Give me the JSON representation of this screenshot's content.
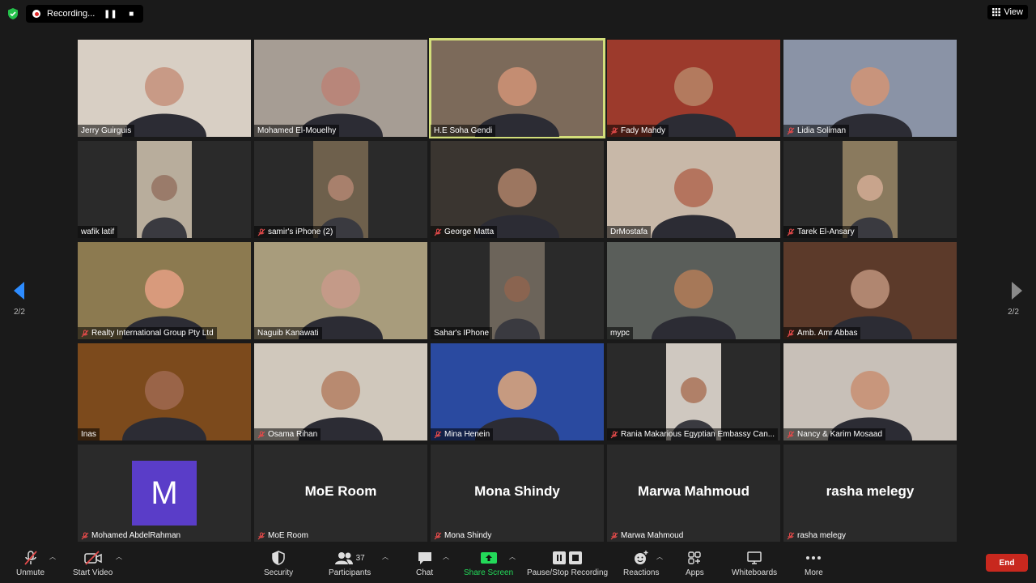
{
  "top_bar": {
    "recording_label": "Recording...",
    "view_label": "View"
  },
  "navigation": {
    "page_indicator_left": "2/2",
    "page_indicator_right": "2/2"
  },
  "participants": [
    {
      "name": "Jerry Guirguis",
      "muted": false,
      "bg": "#d8cfc4",
      "face": "#c89a86",
      "portrait": false,
      "active": false
    },
    {
      "name": "Mohamed El-Mouelhy",
      "muted": false,
      "bg": "#a69d94",
      "face": "#b8867a",
      "portrait": false,
      "active": false
    },
    {
      "name": "H.E Soha Gendi",
      "muted": false,
      "bg": "#7c6a5a",
      "face": "#c48d72",
      "portrait": false,
      "active": true
    },
    {
      "name": "Fady Mahdy",
      "muted": true,
      "bg": "#9c3a2c",
      "face": "#b37a5e",
      "portrait": false,
      "active": false
    },
    {
      "name": "Lidia Soliman",
      "muted": true,
      "bg": "#8a93a6",
      "face": "#c8947c",
      "portrait": false,
      "active": false
    },
    {
      "name": "wafik latif",
      "muted": false,
      "bg": "#b8ad9c",
      "face": "#9a7b6a",
      "portrait": true,
      "active": false
    },
    {
      "name": "samir's iPhone (2)",
      "muted": true,
      "bg": "#6e604c",
      "face": "#a8806c",
      "portrait": true,
      "active": false
    },
    {
      "name": "George Matta",
      "muted": true,
      "bg": "#3a3530",
      "face": "#9c7660",
      "portrait": false,
      "active": false
    },
    {
      "name": "DrMostafa",
      "muted": false,
      "bg": "#c8b8a8",
      "face": "#b4745e",
      "portrait": false,
      "active": false
    },
    {
      "name": "Tarek El-Ansary",
      "muted": true,
      "bg": "#8a7a5e",
      "face": "#c8a48c",
      "portrait": true,
      "active": false
    },
    {
      "name": "Realty International Group Pty Ltd",
      "muted": true,
      "bg": "#8c7a50",
      "face": "#d89a7c",
      "portrait": false,
      "active": false
    },
    {
      "name": "Naguib Kanawati",
      "muted": false,
      "bg": "#a89c7c",
      "face": "#c49a88",
      "portrait": false,
      "active": false
    },
    {
      "name": "Sahar's IPhone",
      "muted": false,
      "bg": "#6c645a",
      "face": "#8a6450",
      "portrait": true,
      "active": false
    },
    {
      "name": "mypc",
      "muted": false,
      "bg": "#5a5e5a",
      "face": "#a67858",
      "portrait": false,
      "active": false
    },
    {
      "name": "Amb. Amr Abbas",
      "muted": true,
      "bg": "#5c3a2a",
      "face": "#b08670",
      "portrait": false,
      "active": false
    },
    {
      "name": "Inas",
      "muted": false,
      "bg": "#7c4a1c",
      "face": "#9a6448",
      "portrait": false,
      "active": false
    },
    {
      "name": "Osama Rihan",
      "muted": true,
      "bg": "#d0c8bc",
      "face": "#b88a70",
      "portrait": false,
      "active": false
    },
    {
      "name": "Mina Henein",
      "muted": true,
      "bg": "#2a4aa0",
      "face": "#c69a80",
      "portrait": false,
      "active": false
    },
    {
      "name": "Rania Makarious Egyptian Embassy Can...",
      "muted": true,
      "bg": "#cfc8c0",
      "face": "#b08068",
      "portrait": true,
      "active": false
    },
    {
      "name": "Nancy & Karim Mosaad",
      "muted": true,
      "bg": "#c8c0b8",
      "face": "#c8967c",
      "portrait": false,
      "active": false
    }
  ],
  "no_video": [
    {
      "name": "Mohamed AbdelRahman",
      "muted": true,
      "display": "",
      "avatar_letter": "M"
    },
    {
      "name": "MoE Room",
      "muted": true,
      "display": "MoE Room",
      "avatar_letter": ""
    },
    {
      "name": "Mona Shindy",
      "muted": true,
      "display": "Mona Shindy",
      "avatar_letter": ""
    },
    {
      "name": "Marwa Mahmoud",
      "muted": true,
      "display": "Marwa Mahmoud",
      "avatar_letter": ""
    },
    {
      "name": "rasha melegy",
      "muted": true,
      "display": "rasha melegy",
      "avatar_letter": ""
    }
  ],
  "toolbar": {
    "unmute": "Unmute",
    "start_video": "Start Video",
    "security": "Security",
    "participants": "Participants",
    "participants_count": "37",
    "chat": "Chat",
    "share_screen": "Share Screen",
    "pause_stop_recording": "Pause/Stop Recording",
    "reactions": "Reactions",
    "apps": "Apps",
    "whiteboards": "Whiteboards",
    "more": "More",
    "end": "End"
  },
  "colors": {
    "active_speaker": "#d3de7a",
    "share_green": "#23d959",
    "end_red": "#c8281e",
    "mute_red": "#e24a4a",
    "nav_blue": "#2d8cff"
  }
}
